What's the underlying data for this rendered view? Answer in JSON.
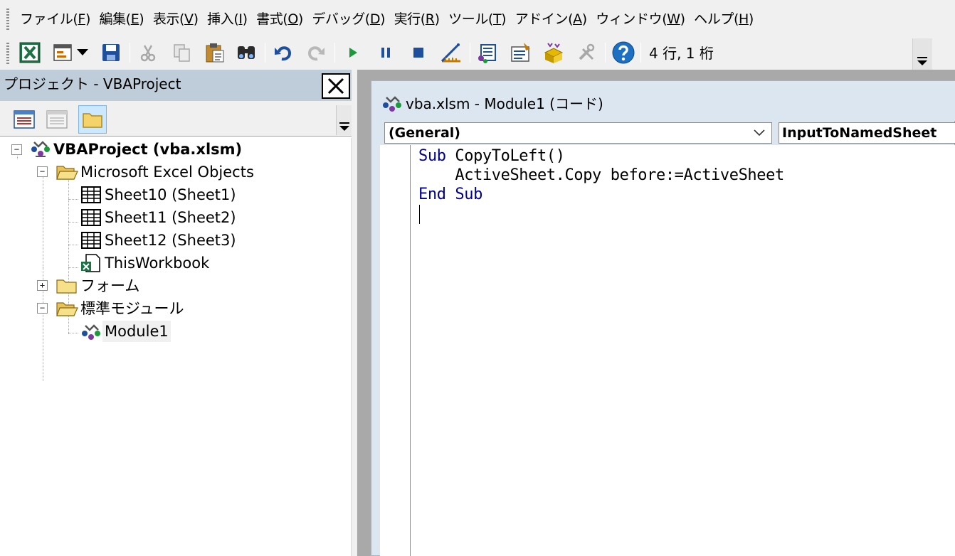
{
  "menubar": {
    "items": [
      {
        "text": "ファイル(",
        "acc": "F",
        "end": ")"
      },
      {
        "text": "編集(",
        "acc": "E",
        "end": ")"
      },
      {
        "text": "表示(",
        "acc": "V",
        "end": ")"
      },
      {
        "text": "挿入(",
        "acc": "I",
        "end": ")"
      },
      {
        "text": "書式(",
        "acc": "O",
        "end": ")"
      },
      {
        "text": "デバッグ(",
        "acc": "D",
        "end": ")"
      },
      {
        "text": "実行(",
        "acc": "R",
        "end": ")"
      },
      {
        "text": "ツール(",
        "acc": "T",
        "end": ")"
      },
      {
        "text": "アドイン(",
        "acc": "A",
        "end": ")"
      },
      {
        "text": "ウィンドウ(",
        "acc": "W",
        "end": ")"
      },
      {
        "text": "ヘルプ(",
        "acc": "H",
        "end": ")"
      }
    ]
  },
  "toolbar": {
    "cursor_position": "4 行, 1 桁",
    "buttons": [
      {
        "name": "view-excel-button",
        "icon": "excel-icon",
        "enabled": true
      },
      {
        "name": "insert-userform-button",
        "icon": "userform-icon",
        "enabled": true
      },
      {
        "name": "insert-dropdown-button",
        "icon": "dropdown-arrow-icon",
        "enabled": true
      },
      {
        "name": "save-button",
        "icon": "save-icon",
        "enabled": true
      },
      {
        "name": "cut-button",
        "icon": "cut-icon",
        "enabled": false
      },
      {
        "name": "copy-button",
        "icon": "copy-icon",
        "enabled": false
      },
      {
        "name": "paste-button",
        "icon": "paste-icon",
        "enabled": true
      },
      {
        "name": "find-button",
        "icon": "binoculars-icon",
        "enabled": true
      },
      {
        "name": "undo-button",
        "icon": "undo-icon",
        "enabled": true
      },
      {
        "name": "redo-button",
        "icon": "redo-icon",
        "enabled": false
      },
      {
        "name": "run-button",
        "icon": "play-icon",
        "enabled": true
      },
      {
        "name": "break-button",
        "icon": "pause-icon",
        "enabled": true
      },
      {
        "name": "reset-button",
        "icon": "stop-icon",
        "enabled": true
      },
      {
        "name": "design-mode-button",
        "icon": "design-mode-icon",
        "enabled": true
      },
      {
        "name": "project-explorer-button",
        "icon": "project-explorer-icon",
        "enabled": true
      },
      {
        "name": "properties-window-button",
        "icon": "properties-icon",
        "enabled": true
      },
      {
        "name": "object-browser-button",
        "icon": "object-browser-icon",
        "enabled": true
      },
      {
        "name": "toolbox-button",
        "icon": "toolbox-icon",
        "enabled": false
      },
      {
        "name": "help-button",
        "icon": "help-icon",
        "enabled": true
      }
    ]
  },
  "project_explorer": {
    "title": "プロジェクト - VBAProject",
    "toolbar_icons": [
      "view-code-icon",
      "view-object-icon",
      "toggle-folders-icon"
    ],
    "tree": {
      "root": "VBAProject (vba.xlsm)",
      "excel_objects": "Microsoft Excel Objects",
      "sheets": [
        "Sheet10 (Sheet1)",
        "Sheet11 (Sheet2)",
        "Sheet12 (Sheet3)"
      ],
      "workbook": "ThisWorkbook",
      "forms": "フォーム",
      "modules_folder": "標準モジュール",
      "module": "Module1"
    },
    "expander_collapsed": "+",
    "expander_expanded": "−"
  },
  "code_window": {
    "title": "vba.xlsm - Module1 (コード)",
    "object_combo": "(General)",
    "procedure_combo": "InputToNamedSheet",
    "code": {
      "line1_kw": "Sub",
      "line1_rest": " CopyToLeft()",
      "line2": "    ActiveSheet.Copy before:=ActiveSheet",
      "line3_kw1": "End",
      "line3_kw2": "Sub"
    }
  },
  "colors": {
    "keyword": "#00008b",
    "panel_title_bg": "#bfcddb",
    "code_window_bg": "#dce6f1",
    "mdi_bg": "#a9a9a9"
  }
}
